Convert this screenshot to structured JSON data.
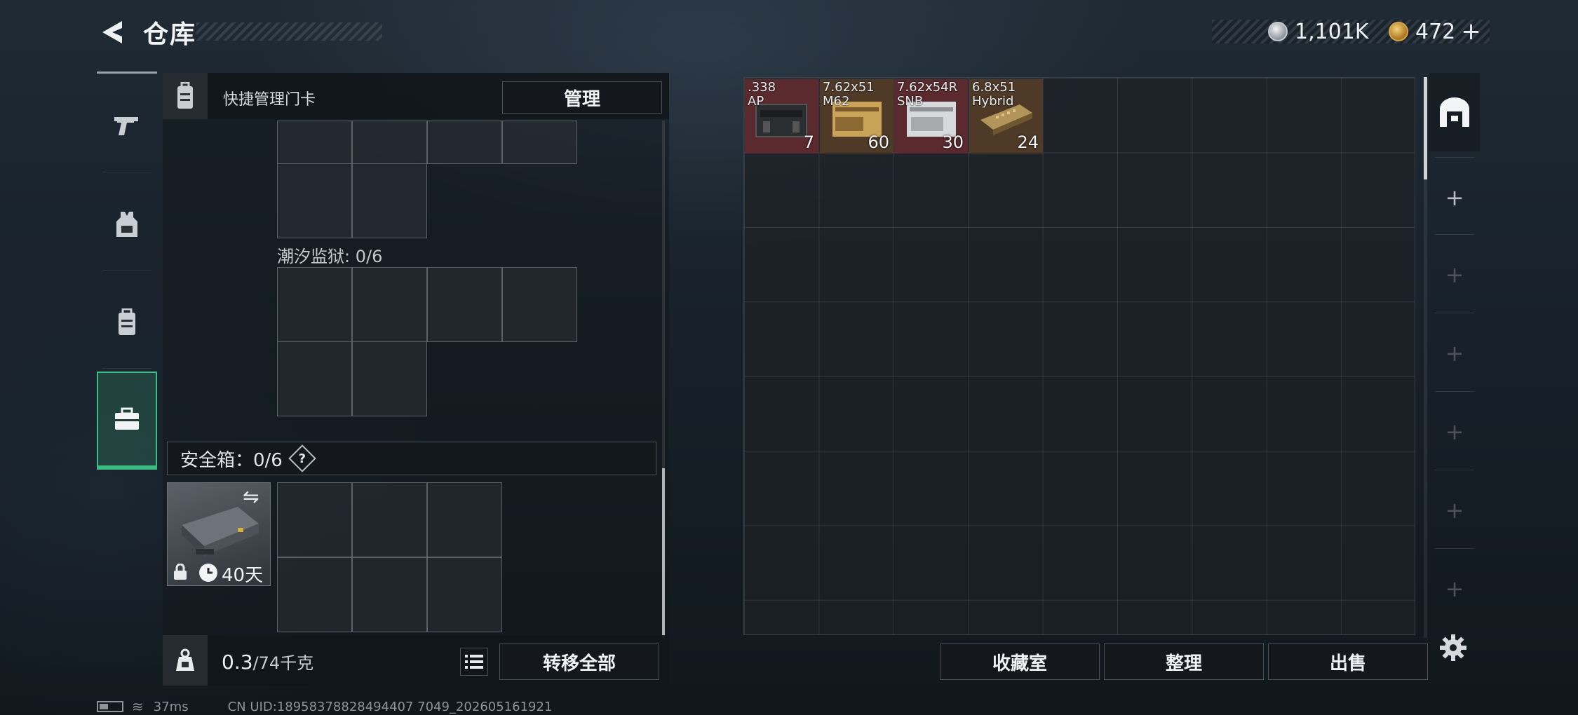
{
  "header": {
    "title": "仓库",
    "back_icon": "chevron-left-icon"
  },
  "currency": {
    "silver": "1,101K",
    "gold": "472",
    "gold_add": "+"
  },
  "sidebar": {
    "items": [
      {
        "icon": "pistol-icon"
      },
      {
        "icon": "chest-rig-icon"
      },
      {
        "icon": "backpack-icon"
      },
      {
        "icon": "briefcase-icon",
        "active": true
      }
    ]
  },
  "left_panel": {
    "quick_manage_label": "快捷管理门卡",
    "manage_button": "管理",
    "tidal_prison_label": "潮汐监狱: 0/6",
    "safe_box_label": "安全箱：0/6",
    "help_label": "?",
    "case_days": "40天",
    "weight_current": "0.3",
    "weight_max": "/74千克",
    "transfer_all": "转移全部"
  },
  "stash": {
    "items": [
      {
        "caliber": ".338",
        "type": "AP",
        "qty": "7",
        "bg": "#5a2a2e"
      },
      {
        "caliber": "7.62x51",
        "type": "M62",
        "qty": "60",
        "bg": "#4e3a27"
      },
      {
        "caliber": "7.62x54R",
        "type": "SNB",
        "qty": "30",
        "bg": "#5a2a2e"
      },
      {
        "caliber": "6.8x51",
        "type": "Hybrid",
        "qty": "24",
        "bg": "#4e3a27"
      }
    ],
    "buttons": {
      "collection": "收藏室",
      "organize": "整理",
      "sell": "出售"
    }
  },
  "status_bar": {
    "ping": "37ms",
    "uid": "CN UID:18958378828494407 7049_202605161921"
  },
  "colors": {
    "accent_green": "#3bbd84",
    "rarity_red": "#5a2a2e",
    "rarity_gold": "#4e3a27"
  }
}
